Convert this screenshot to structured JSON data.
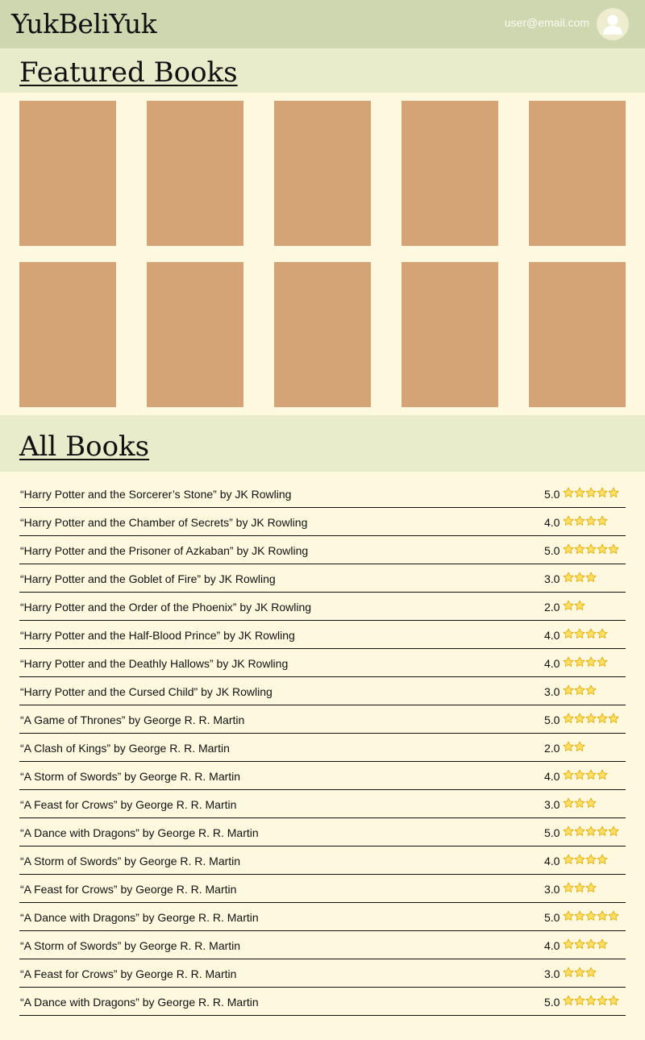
{
  "header": {
    "logo": "YukBeliYuk",
    "user_email": "user@email.com",
    "avatar_icon": "user-avatar-icon"
  },
  "featured": {
    "title": "Featured Books",
    "cover_color": "#d4a474",
    "cover_count": 10
  },
  "all_books": {
    "title": "All Books",
    "star_icon": "star-icon",
    "books": [
      {
        "title": "“Harry Potter and the Sorcerer’s Stone” by JK Rowling",
        "rating": "5.0",
        "stars": 5
      },
      {
        "title": "“Harry Potter and the Chamber of Secrets” by JK Rowling",
        "rating": "4.0",
        "stars": 4
      },
      {
        "title": "“Harry Potter and the Prisoner of Azkaban” by JK Rowling",
        "rating": "5.0",
        "stars": 5
      },
      {
        "title": "“Harry Potter and the Goblet of Fire” by JK Rowling",
        "rating": "3.0",
        "stars": 3
      },
      {
        "title": "“Harry Potter and the Order of the Phoenix” by JK Rowling",
        "rating": "2.0",
        "stars": 2
      },
      {
        "title": "“Harry Potter and the Half-Blood Prince” by JK Rowling",
        "rating": "4.0",
        "stars": 4
      },
      {
        "title": "“Harry Potter and the Deathly Hallows” by JK Rowling",
        "rating": "4.0",
        "stars": 4
      },
      {
        "title": "“Harry Potter and the Cursed Child” by JK Rowling",
        "rating": "3.0",
        "stars": 3
      },
      {
        "title": "“A Game of Thrones” by George R. R. Martin",
        "rating": "5.0",
        "stars": 5
      },
      {
        "title": "“A Clash of Kings” by George R. R. Martin",
        "rating": "2.0",
        "stars": 2
      },
      {
        "title": "“A Storm of Swords” by George R. R. Martin",
        "rating": "4.0",
        "stars": 4
      },
      {
        "title": "“A Feast for Crows” by George R. R. Martin",
        "rating": "3.0",
        "stars": 3
      },
      {
        "title": "“A Dance with Dragons” by George R. R. Martin",
        "rating": "5.0",
        "stars": 5
      },
      {
        "title": "“A Storm of Swords” by George R. R. Martin",
        "rating": "4.0",
        "stars": 4
      },
      {
        "title": "“A Feast for Crows” by George R. R. Martin",
        "rating": "3.0",
        "stars": 3
      },
      {
        "title": "“A Dance with Dragons” by George R. R. Martin",
        "rating": "5.0",
        "stars": 5
      },
      {
        "title": "“A Storm of Swords” by George R. R. Martin",
        "rating": "4.0",
        "stars": 4
      },
      {
        "title": "“A Feast for Crows” by George R. R. Martin",
        "rating": "3.0",
        "stars": 3
      },
      {
        "title": "“A Dance with Dragons” by George R. R. Martin",
        "rating": "5.0",
        "stars": 5
      }
    ]
  },
  "colors": {
    "header_bg": "#cfd7b0",
    "band_bg": "#e8ecca",
    "page_bg": "#fdf8de",
    "star_fill": "#ffe066",
    "star_stroke": "#e0a800"
  }
}
